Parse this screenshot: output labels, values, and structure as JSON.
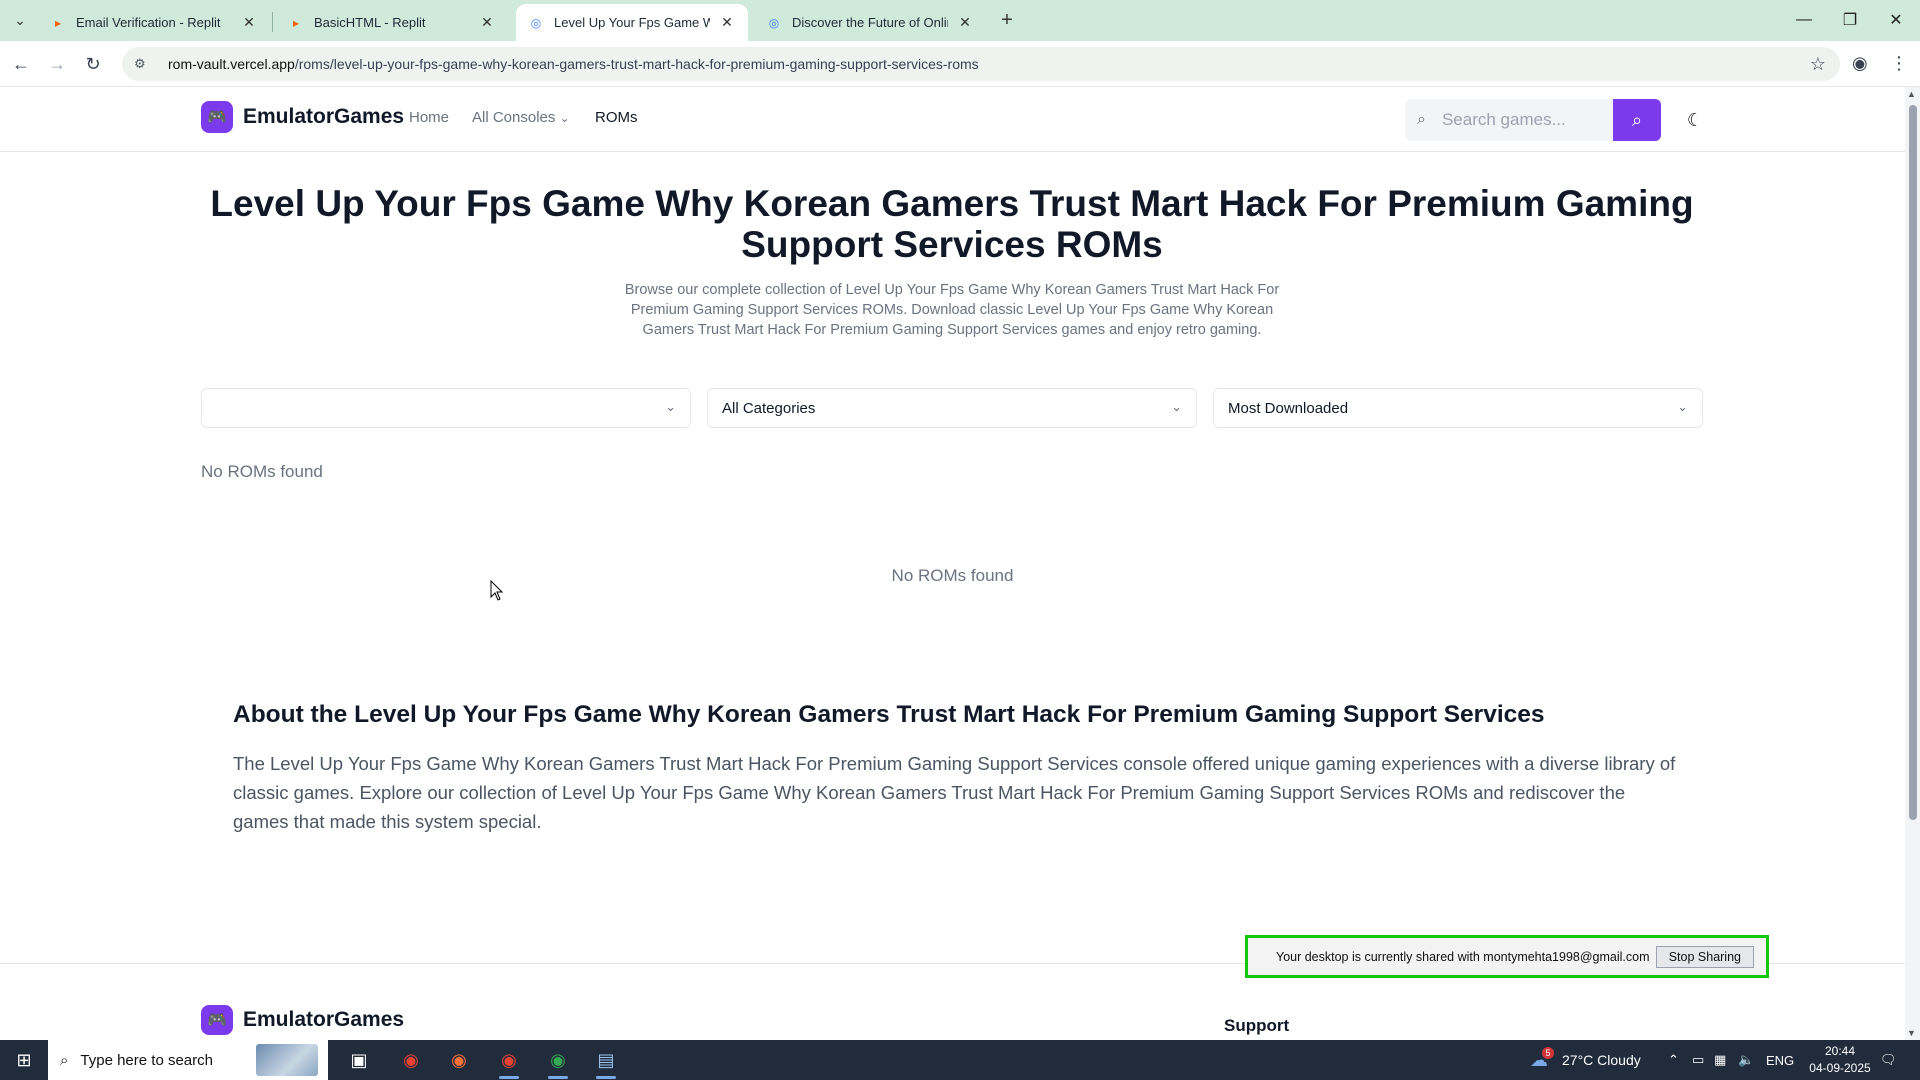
{
  "browser": {
    "tabs": [
      {
        "title": "Email Verification - Replit",
        "favicon": "replit-icon",
        "active": false
      },
      {
        "title": "BasicHTML - Replit",
        "favicon": "replit-icon",
        "active": false
      },
      {
        "title": "Level Up Your Fps Game Why K",
        "favicon": "globe-icon",
        "active": true
      },
      {
        "title": "Discover the Future of Online S",
        "favicon": "globe-icon",
        "active": false
      }
    ],
    "url_host": "rom-vault.vercel.app",
    "url_path": "/roms/level-up-your-fps-game-why-korean-gamers-trust-mart-hack-for-premium-gaming-support-services-roms"
  },
  "site": {
    "brand": "EmulatorGames",
    "nav": {
      "home": "Home",
      "consoles": "All Consoles",
      "roms": "ROMs"
    },
    "search_placeholder": "Search games..."
  },
  "hero": {
    "title": "Level Up Your Fps Game Why Korean Gamers Trust Mart Hack For Premium Gaming Support Services ROMs",
    "description": "Browse our complete collection of Level Up Your Fps Game Why Korean Gamers Trust Mart Hack For Premium Gaming Support Services ROMs. Download classic Level Up Your Fps Game Why Korean Gamers Trust Mart Hack For Premium Gaming Support Services games and enjoy retro gaming."
  },
  "filters": {
    "console": "",
    "category": "All Categories",
    "sort": "Most Downloaded"
  },
  "results": {
    "empty_label": "No ROMs found",
    "empty_center": "No ROMs found"
  },
  "about": {
    "title": "About the Level Up Your Fps Game Why Korean Gamers Trust Mart Hack For Premium Gaming Support Services",
    "text": "The Level Up Your Fps Game Why Korean Gamers Trust Mart Hack For Premium Gaming Support Services console offered unique gaming experiences with a diverse library of classic games. Explore our collection of Level Up Your Fps Game Why Korean Gamers Trust Mart Hack For Premium Gaming Support Services ROMs and rediscover the games that made this system special."
  },
  "footer": {
    "brand": "EmulatorGames",
    "support": "Support"
  },
  "share_bar": {
    "message": "Your desktop is currently shared with montymehta1998@gmail.com",
    "stop": "Stop Sharing"
  },
  "taskbar": {
    "search_text": "Type here to search",
    "weather": "27°C  Cloudy",
    "weather_badge": "5",
    "lang": "ENG",
    "time": "20:44",
    "date": "04-09-2025"
  },
  "colors": {
    "brand": "#7c3aed",
    "tabstrip": "#cfeadb",
    "share_border": "#16c60c",
    "taskbar": "#202b3c"
  }
}
